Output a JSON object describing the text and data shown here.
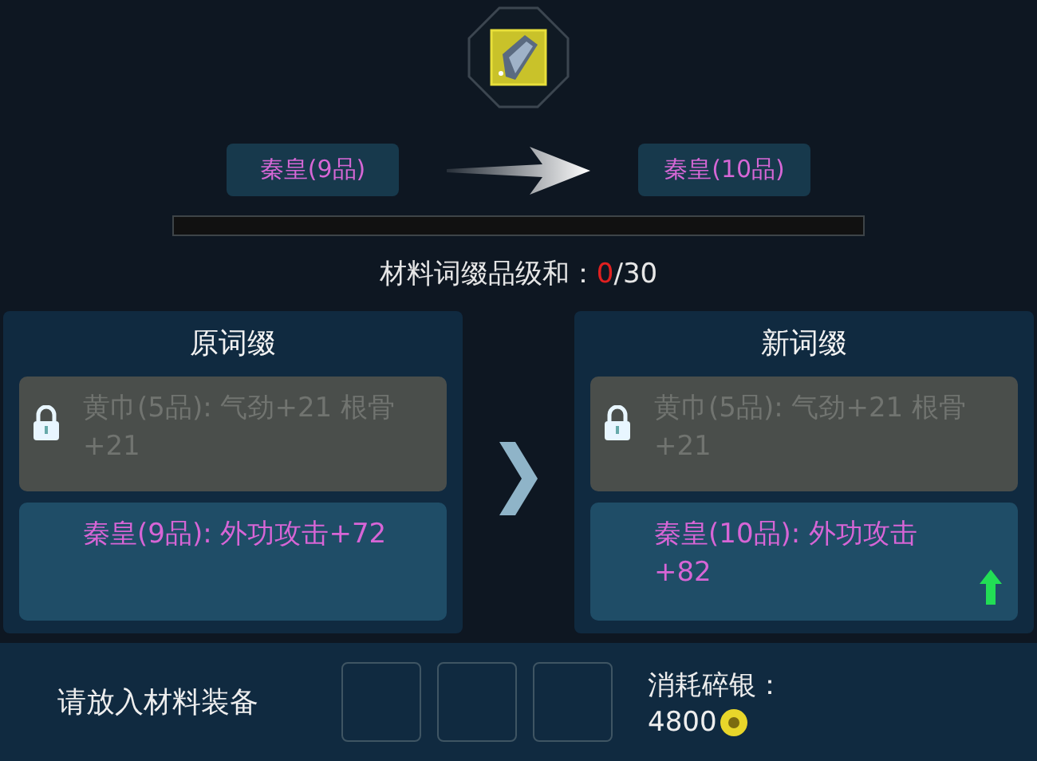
{
  "upgrade": {
    "from": "秦皇(9品)",
    "to": "秦皇(10品)"
  },
  "progress": {
    "level": 0
  },
  "quality_sum": {
    "label": "材料词缀品级和：",
    "current": "0",
    "total": "/30"
  },
  "panels": [
    {
      "title": "原词缀",
      "affixes": [
        {
          "text": "黄巾(5品): 气劲+21 根骨+21",
          "locked": true,
          "upgraded": false
        },
        {
          "text": "秦皇(9品): 外功攻击+72",
          "locked": false,
          "upgraded": false
        }
      ]
    },
    {
      "title": "新词缀",
      "affixes": [
        {
          "text": "黄巾(5品): 气劲+21 根骨+21",
          "locked": true,
          "upgraded": false
        },
        {
          "text": "秦皇(10品): 外功攻击+82",
          "locked": false,
          "upgraded": true
        }
      ]
    }
  ],
  "materials": {
    "label": "请放入材料装备",
    "slots": [
      {
        "filled": false
      },
      {
        "filled": false
      },
      {
        "filled": false
      }
    ]
  },
  "cost": {
    "label": "消耗碎银：",
    "amount": "4800"
  }
}
